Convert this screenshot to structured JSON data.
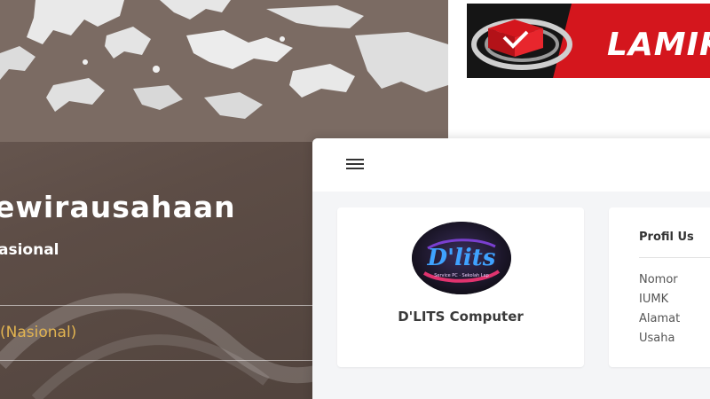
{
  "hero": {
    "title": "ewirausahaan",
    "subtitle": "asional",
    "scope": "(Nasional)"
  },
  "brand": {
    "name": "LAMIK",
    "red": "#d4161d",
    "dark": "#151515"
  },
  "app": {
    "menu_icon": "hamburger-icon",
    "profile_card": {
      "logo_text": "D'lits",
      "logo_tagline": "Service PC · Sekolah Lap",
      "company_name": "D'LITS Computer"
    },
    "info_card": {
      "title": "Profil Us",
      "labels": [
        "Nomor",
        "IUMK",
        "Alamat",
        "Usaha"
      ]
    }
  },
  "colors": {
    "hero_bg": "#5d4d46",
    "hero_accent": "#e2b451",
    "app_bg": "#f4f5f7"
  }
}
